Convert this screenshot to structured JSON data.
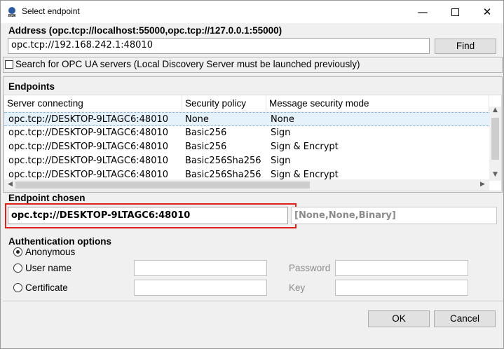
{
  "window": {
    "title": "Select endpoint"
  },
  "address": {
    "label": "Address (opc.tcp://localhost:55000,opc.tcp://127.0.0.1:55000)",
    "value": "opc.tcp://192.168.242.1:48010",
    "find_label": "Find"
  },
  "search": {
    "label": "Search for OPC UA servers (Local Discovery Server must be launched previously)",
    "checked": false
  },
  "endpoints": {
    "label": "Endpoints",
    "columns": [
      "Server connecting",
      "Security policy",
      "Message security mode"
    ],
    "rows": [
      {
        "server": "opc.tcp://DESKTOP-9LTAGC6:48010",
        "policy": "None",
        "mode": "None"
      },
      {
        "server": "opc.tcp://DESKTOP-9LTAGC6:48010",
        "policy": "Basic256",
        "mode": "Sign"
      },
      {
        "server": "opc.tcp://DESKTOP-9LTAGC6:48010",
        "policy": "Basic256",
        "mode": "Sign & Encrypt"
      },
      {
        "server": "opc.tcp://DESKTOP-9LTAGC6:48010",
        "policy": "Basic256Sha256",
        "mode": "Sign"
      },
      {
        "server": "opc.tcp://DESKTOP-9LTAGC6:48010",
        "policy": "Basic256Sha256",
        "mode": "Sign & Encrypt"
      }
    ]
  },
  "chosen": {
    "label": "Endpoint chosen",
    "value": "opc.tcp://DESKTOP-9LTAGC6:48010",
    "details": "[None,None,Binary]",
    "highlight_color": "#e0201b"
  },
  "auth": {
    "label": "Authentication options",
    "anonymous": "Anonymous",
    "username": "User name",
    "certificate": "Certificate",
    "password_label": "Password",
    "key_label": "Key",
    "selected": "anonymous"
  },
  "buttons": {
    "ok": "OK",
    "cancel": "Cancel"
  }
}
